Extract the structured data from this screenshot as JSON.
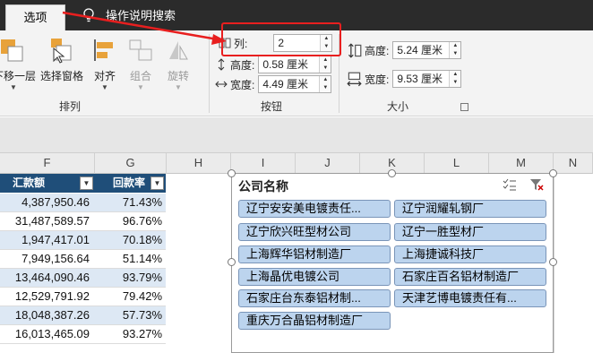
{
  "tabs": {
    "active": "选项",
    "tell_me": "操作说明搜索"
  },
  "ribbon": {
    "arrange": {
      "send_backward": "下移一层",
      "selection_pane": "选择窗格",
      "align": "对齐",
      "group": "组合",
      "rotate": "旋转",
      "label": "排列"
    },
    "buttons_group": {
      "columns_label": "列:",
      "columns_value": "2",
      "height_label": "高度:",
      "height_value": "0.58 厘米",
      "width_label": "宽度:",
      "width_value": "4.49 厘米",
      "label": "按钮"
    },
    "size_group": {
      "height_label": "高度:",
      "height_value": "5.24 厘米",
      "width_label": "宽度:",
      "width_value": "9.53 厘米",
      "label": "大小"
    }
  },
  "columns": [
    "F",
    "G",
    "H",
    "I",
    "J",
    "K",
    "L",
    "M",
    "N"
  ],
  "table": {
    "headers": [
      "汇款额",
      "回款率"
    ],
    "rows": [
      [
        "4,387,950.46",
        "71.43%"
      ],
      [
        "31,487,589.57",
        "96.76%"
      ],
      [
        "1,947,417.01",
        "70.18%"
      ],
      [
        "7,949,156.64",
        "51.14%"
      ],
      [
        "13,464,090.46",
        "93.79%"
      ],
      [
        "12,529,791.92",
        "79.42%"
      ],
      [
        "18,048,387.26",
        "57.73%"
      ],
      [
        "16,013,465.09",
        "93.27%"
      ]
    ]
  },
  "slicer": {
    "title": "公司名称",
    "items": [
      "辽宁安安美电镀责任...",
      "辽宁润耀轧钢厂",
      "辽宁欣兴旺型材公司",
      "辽宁一胜型材厂",
      "上海辉华铝材制造厂",
      "上海捷诚科技厂",
      "上海晶优电镀公司",
      "石家庄百名铝材制造厂",
      "石家庄台东泰铝材制...",
      "天津艺博电镀责任有...",
      "重庆万合晶铝材制造厂"
    ]
  },
  "colors": {
    "tabbar": "#2b2b2b",
    "ribbon": "#f3f3f3",
    "header_fill": "#1f4e79",
    "row_band": "#dde8f4",
    "slicer_item": "#bcd4ee",
    "callout": "#e81f1f"
  },
  "icons": [
    "lightbulb-icon",
    "send-backward-icon",
    "selection-pane-icon",
    "align-icon",
    "group-icon",
    "rotate-icon",
    "multi-select-icon",
    "clear-filter-icon",
    "filter-dropdown-icon"
  ]
}
